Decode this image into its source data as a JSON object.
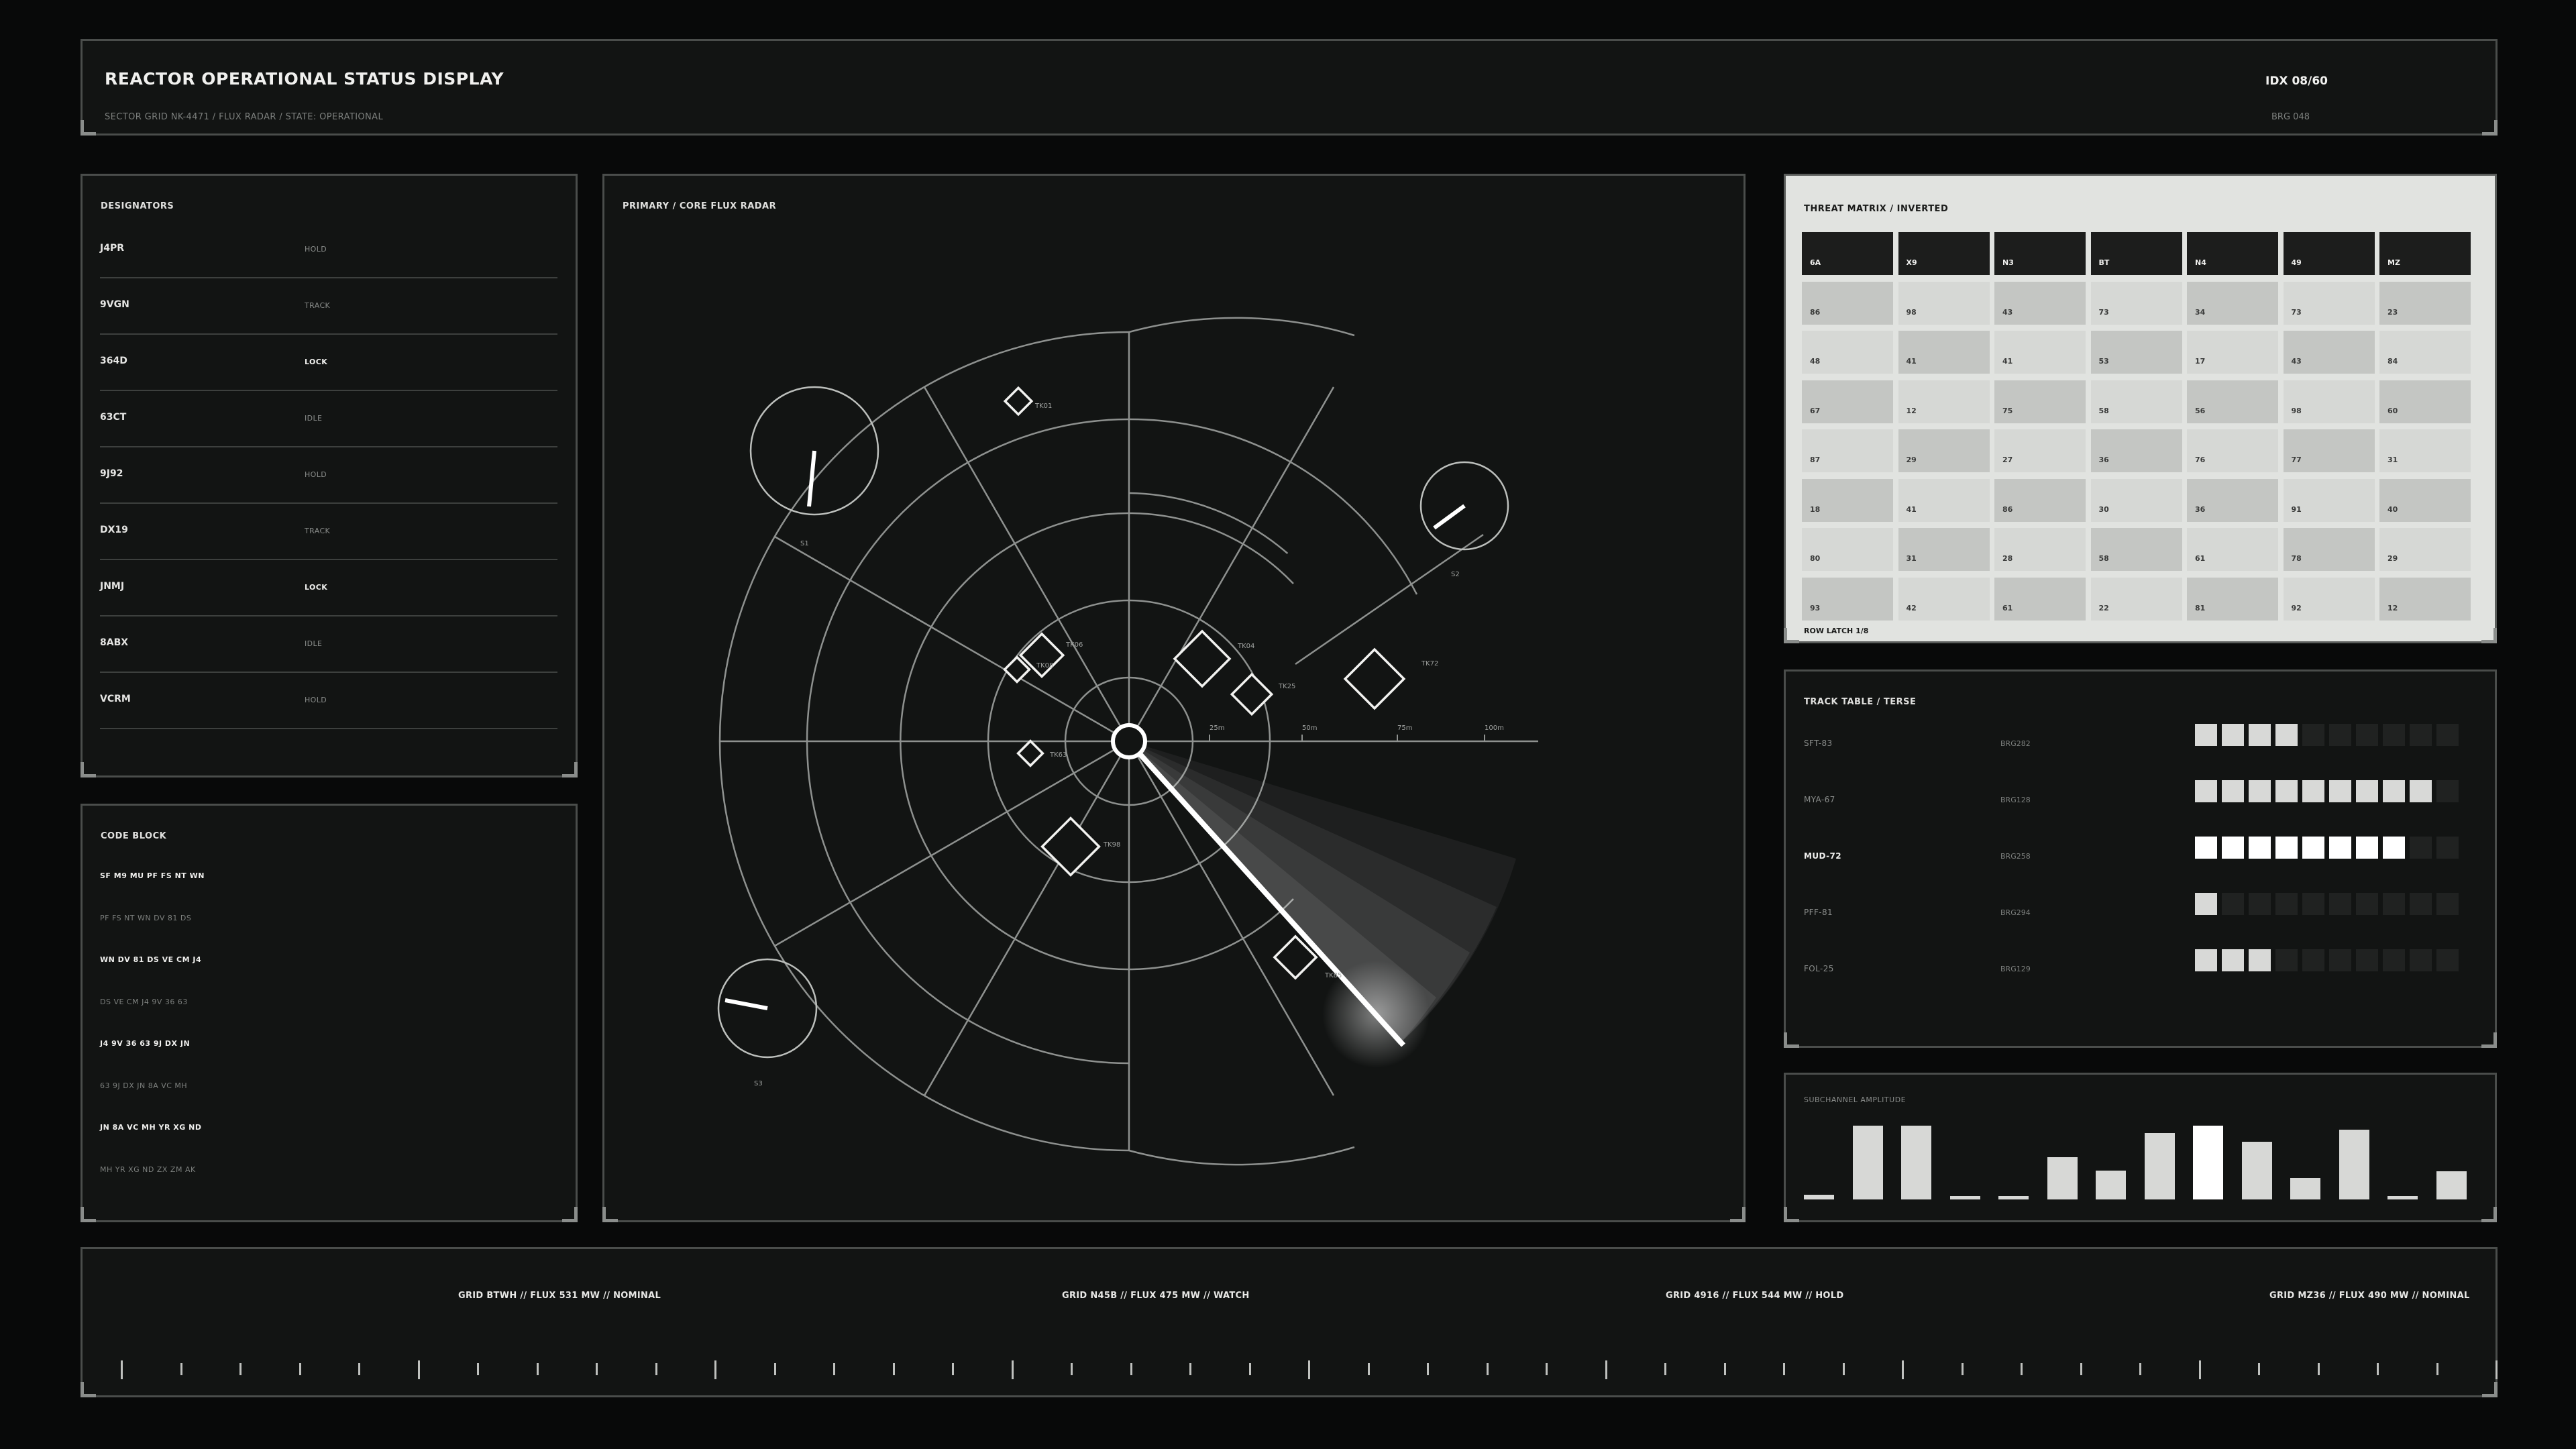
{
  "header": {
    "title": "REACTOR OPERATIONAL STATUS DISPLAY",
    "subtitle": "SECTOR GRID NK-4471 / FLUX RADAR / STATE: OPERATIONAL",
    "idx": "IDX 08/60",
    "brg": "BRG 048"
  },
  "designators": {
    "title": "DESIGNATORS",
    "rows": [
      {
        "code": "J4PR",
        "state": "HOLD"
      },
      {
        "code": "9VGN",
        "state": "TRACK"
      },
      {
        "code": "364D",
        "state": "LOCK"
      },
      {
        "code": "63CT",
        "state": "IDLE"
      },
      {
        "code": "9J92",
        "state": "HOLD"
      },
      {
        "code": "DX19",
        "state": "TRACK"
      },
      {
        "code": "JNMJ",
        "state": "LOCK"
      },
      {
        "code": "8ABX",
        "state": "IDLE"
      },
      {
        "code": "VCRM",
        "state": "HOLD"
      }
    ]
  },
  "code_block": {
    "title": "CODE BLOCK",
    "lines": [
      "SF M9 MU PF FS NT WN",
      "PF FS NT WN DV 81 DS",
      "WN DV 81 DS VE CM J4",
      "DS VE CM J4 9V 36 63",
      "J4 9V 36 63 9J DX JN",
      "63 9J DX JN 8A VC MH",
      "JN 8A VC MH YR XG ND",
      "MH YR XG ND ZX ZM AK"
    ]
  },
  "radar": {
    "title": "PRIMARY / CORE FLUX RADAR",
    "range_labels": [
      "25m",
      "50m",
      "75m",
      "100m"
    ],
    "targets": [
      {
        "id": "TK01"
      },
      {
        "id": "TK06"
      },
      {
        "id": "TK04"
      },
      {
        "id": "TK25"
      },
      {
        "id": "TK72"
      },
      {
        "id": "TK08"
      },
      {
        "id": "TK63"
      },
      {
        "id": "TK98"
      },
      {
        "id": "TK85"
      }
    ],
    "stations": [
      "S1",
      "S2",
      "S3"
    ]
  },
  "threat_matrix": {
    "title": "THREAT MATRIX / INVERTED",
    "headers": [
      "6A",
      "X9",
      "N3",
      "BT",
      "N4",
      "49",
      "MZ"
    ],
    "rows": [
      [
        "86",
        "98",
        "43",
        "73",
        "34",
        "73",
        "23"
      ],
      [
        "48",
        "41",
        "41",
        "53",
        "17",
        "43",
        "84"
      ],
      [
        "67",
        "12",
        "75",
        "58",
        "56",
        "98",
        "60"
      ],
      [
        "87",
        "29",
        "27",
        "36",
        "76",
        "77",
        "31"
      ],
      [
        "18",
        "41",
        "86",
        "30",
        "36",
        "91",
        "40"
      ],
      [
        "80",
        "31",
        "28",
        "58",
        "61",
        "78",
        "29"
      ],
      [
        "93",
        "42",
        "61",
        "22",
        "81",
        "92",
        "12"
      ]
    ],
    "footer": "ROW LATCH 1/8"
  },
  "track_table": {
    "title": "TRACK TABLE / TERSE",
    "rows": [
      {
        "id": "SFT-83",
        "brg": "BRG282",
        "level": 4,
        "highlight": false
      },
      {
        "id": "MYA-67",
        "brg": "BRG128",
        "level": 9,
        "highlight": false
      },
      {
        "id": "MUD-72",
        "brg": "BRG258",
        "level": 8,
        "highlight": true
      },
      {
        "id": "PFF-81",
        "brg": "BRG294",
        "level": 1,
        "highlight": false
      },
      {
        "id": "FOL-25",
        "brg": "BRG129",
        "level": 3,
        "highlight": false
      }
    ]
  },
  "subchannel": {
    "title": "SUBCHANNEL AMPLITUDE",
    "values": [
      0.06,
      1.0,
      1.0,
      0.03,
      0.03,
      0.57,
      0.39,
      0.9,
      1.0,
      0.78,
      0.29,
      0.95,
      0.03,
      0.38
    ]
  },
  "footer": {
    "labels": [
      "GRID BTWH // FLUX 531 MW // NOMINAL",
      "GRID N45B // FLUX 475 MW // WATCH",
      "GRID 4916 // FLUX 544 MW // HOLD",
      "GRID MZ36 // FLUX 490 MW // NOMINAL"
    ]
  },
  "colors": {
    "background": "#080909",
    "panel": "#121413",
    "accent": "#ffffff",
    "matrix_bg": "#e1e3e0"
  }
}
